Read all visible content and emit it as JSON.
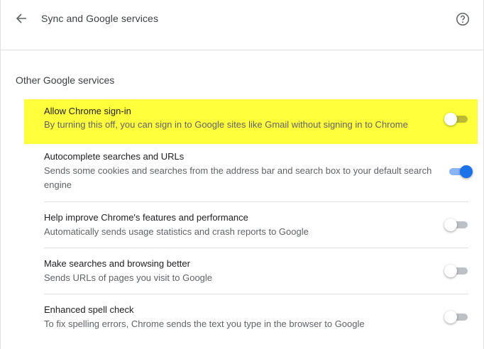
{
  "header": {
    "title": "Sync and Google services",
    "back_icon": "arrow-back-icon",
    "help_icon": "help-circle-icon"
  },
  "section": {
    "title": "Other Google services"
  },
  "settings": [
    {
      "title": "Allow Chrome sign-in",
      "description": "By turning this off, you can sign in to Google sites like Gmail without signing in to Chrome",
      "enabled": false,
      "highlighted": true
    },
    {
      "title": "Autocomplete searches and URLs",
      "description": "Sends some cookies and searches from the address bar and search box to your default search engine",
      "enabled": true
    },
    {
      "title": "Help improve Chrome's features and performance",
      "description": "Automatically sends usage statistics and crash reports to Google",
      "enabled": false
    },
    {
      "title": "Make searches and browsing better",
      "description": "Sends URLs of pages you visit to Google",
      "enabled": false
    },
    {
      "title": "Enhanced spell check",
      "description": "To fix spelling errors, Chrome sends the text you type in the browser to Google",
      "enabled": false
    }
  ],
  "colors": {
    "highlight": "#ffff3b",
    "toggle_on": "#1a73e8",
    "toggle_off": "#bdc1c6"
  }
}
